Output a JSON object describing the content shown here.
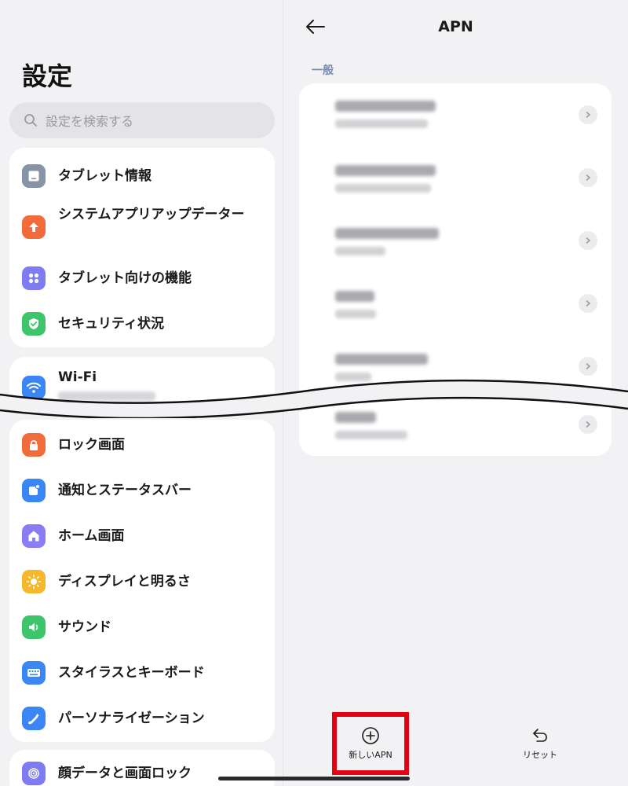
{
  "left": {
    "title": "設定",
    "search_placeholder": "設定を検索する",
    "group1": [
      {
        "label": "タブレット情報",
        "icon": "tablet-info-icon",
        "color": "#8793a6"
      },
      {
        "label": "システムアプリアップデーター",
        "icon": "arrow-up-icon",
        "color": "#f26b3a"
      },
      {
        "label": "タブレット向けの機能",
        "icon": "grid-dots-icon",
        "color": "#7f7bf2"
      },
      {
        "label": "セキュリティ状況",
        "icon": "shield-check-icon",
        "color": "#3ec56b"
      }
    ],
    "wifi": {
      "label": "Wi-Fi",
      "icon": "wifi-icon",
      "color": "#3a86f5"
    },
    "group2": [
      {
        "label": "ロック画面",
        "icon": "lock-icon",
        "color": "#f26b3a"
      },
      {
        "label": "通知とステータスバー",
        "icon": "notification-icon",
        "color": "#3a86f5"
      },
      {
        "label": "ホーム画面",
        "icon": "home-icon",
        "color": "#8a7cf2"
      },
      {
        "label": "ディスプレイと明るさ",
        "icon": "sun-icon",
        "color": "#f5b82a"
      },
      {
        "label": "サウンド",
        "icon": "speaker-icon",
        "color": "#3ec56b"
      },
      {
        "label": "スタイラスとキーボード",
        "icon": "keyboard-icon",
        "color": "#3a86f5"
      },
      {
        "label": "パーソナライゼーション",
        "icon": "brush-icon",
        "color": "#3a86f5"
      }
    ],
    "group3": [
      {
        "label": "顔データと画面ロック",
        "icon": "fingerprint-icon",
        "color": "#7f7bf2"
      }
    ]
  },
  "right": {
    "title": "APN",
    "section": "一般",
    "new_apn_label": "新しいAPN",
    "reset_label": "リセット"
  },
  "colors": {
    "highlight": "#e50012",
    "section_label": "#7a8bb0",
    "background": "#f2f2f4"
  }
}
